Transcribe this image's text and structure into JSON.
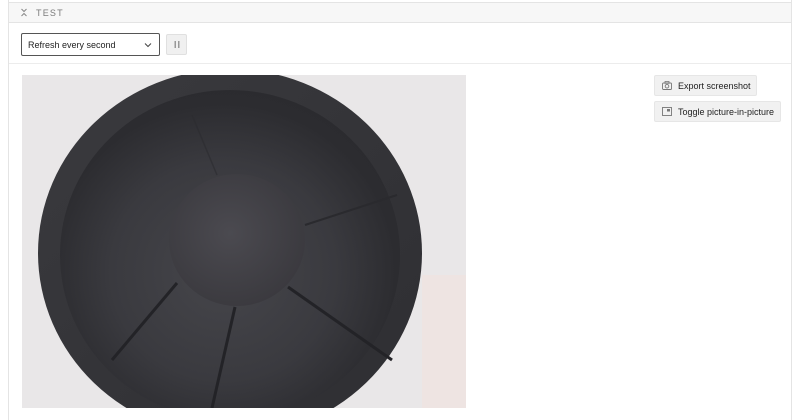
{
  "panel": {
    "title": "TEST",
    "collapse_icon": "collapse-arrows-icon"
  },
  "toolbar": {
    "refresh_select": {
      "value": "Refresh every second"
    },
    "pause_icon": "pause-icon"
  },
  "image": {
    "description_icon": "camera-image"
  },
  "actions": {
    "export_label": "Export screenshot",
    "export_icon": "camera-icon",
    "pip_label": "Toggle picture-in-picture",
    "pip_icon": "picture-in-picture-icon"
  },
  "colors": {
    "header_bg": "#f7f7f7",
    "border": "#e4e4e4",
    "button_bg": "#f1f1f1",
    "image_bg": "#e9e7e8"
  }
}
